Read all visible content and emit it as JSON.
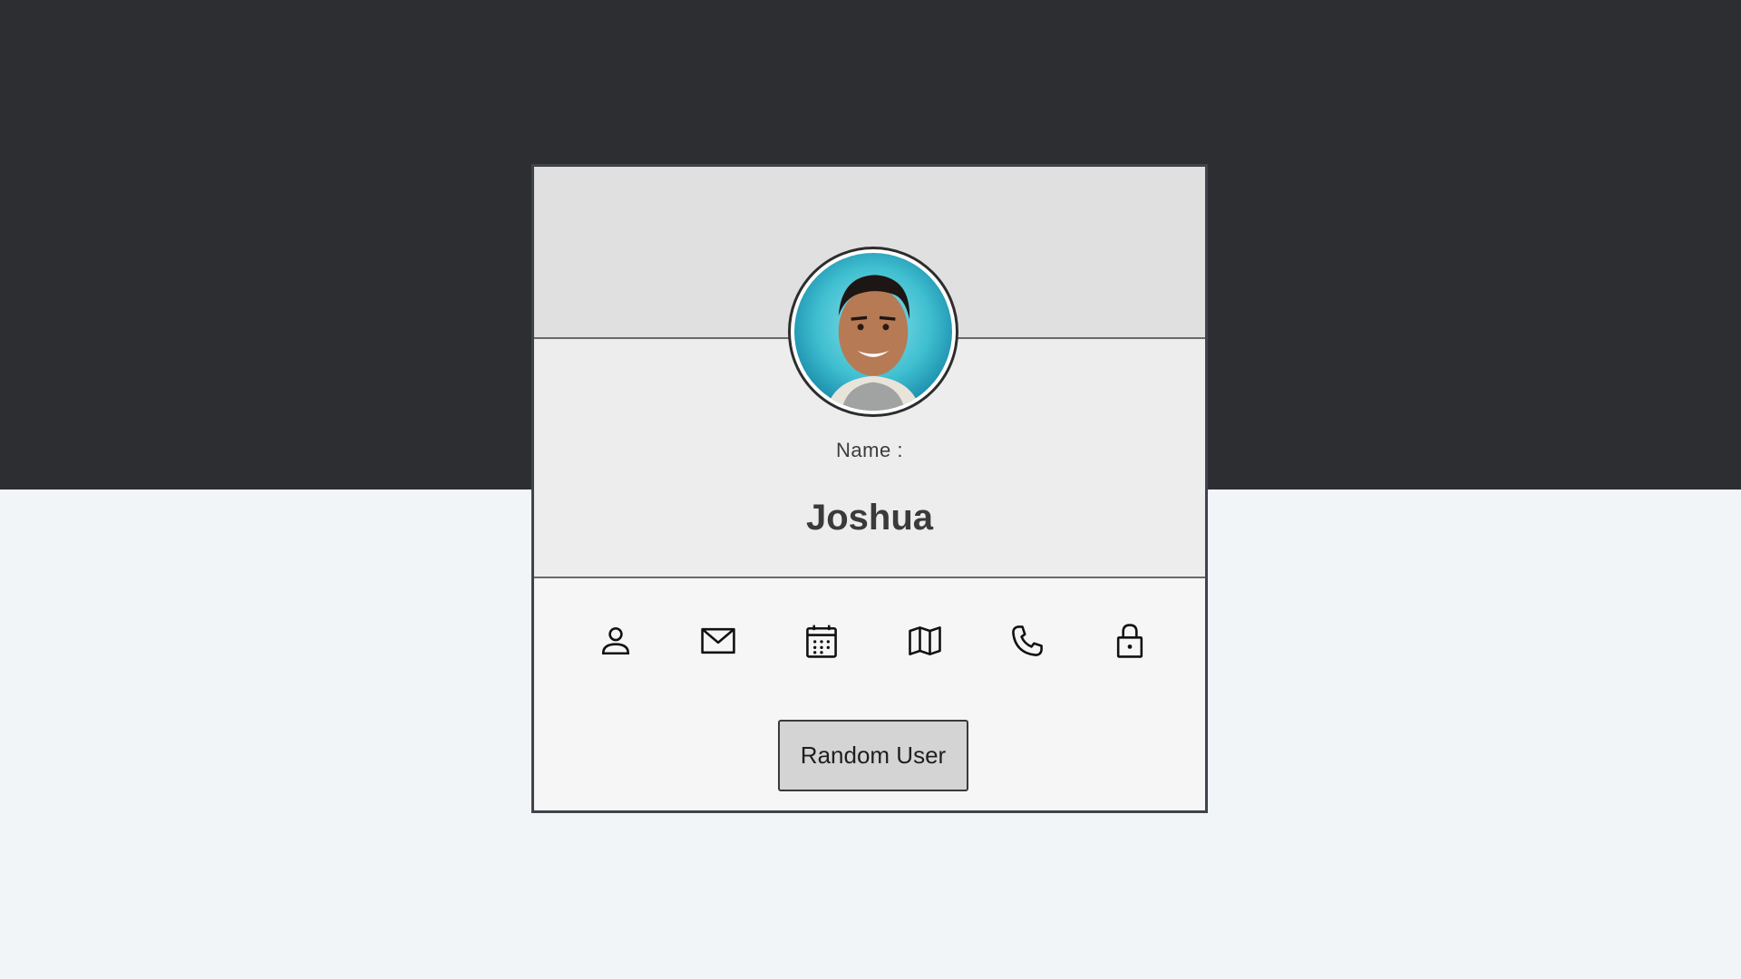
{
  "profile": {
    "name_label": "Name :",
    "name_value": "Joshua",
    "avatar_alt": "Joshua"
  },
  "icons": [
    "user-icon",
    "mail-icon",
    "calendar-icon",
    "map-icon",
    "phone-icon",
    "lock-icon"
  ],
  "actions": {
    "random_label": "Random User"
  },
  "colors": {
    "dark_band": "#2d2e32",
    "page_bg": "#f1f5f8",
    "card_header": "#e0e0e0",
    "card_info": "#ededed",
    "card_body": "#f6f6f6",
    "button_bg": "#d4d4d4"
  }
}
